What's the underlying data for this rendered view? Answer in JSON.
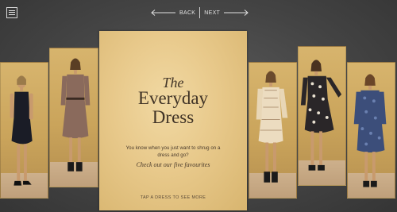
{
  "nav": {
    "back_label": "BACK",
    "next_label": "NEXT"
  },
  "icons": {
    "menu": "hamburger-menu-icon",
    "back": "arrow-left-icon",
    "next": "arrow-right-icon"
  },
  "colors": {
    "background": "#444444",
    "panel": "#e8c98b",
    "text": "#403326"
  },
  "panel": {
    "title_the": "The",
    "title_line1": "Everyday",
    "title_line2": "Dress",
    "intro": "You know when you just want to shrug on a dress and go?",
    "favourites": "Check out our five favourites",
    "cta": "TAP A DRESS TO SEE MORE"
  },
  "dresses": [
    {
      "name": "Black sleeveless dress"
    },
    {
      "name": "Mauve long-sleeve belted dress"
    },
    {
      "name": "Cream embroidered dress"
    },
    {
      "name": "Black and white print dress"
    },
    {
      "name": "Blue floral dress"
    }
  ]
}
